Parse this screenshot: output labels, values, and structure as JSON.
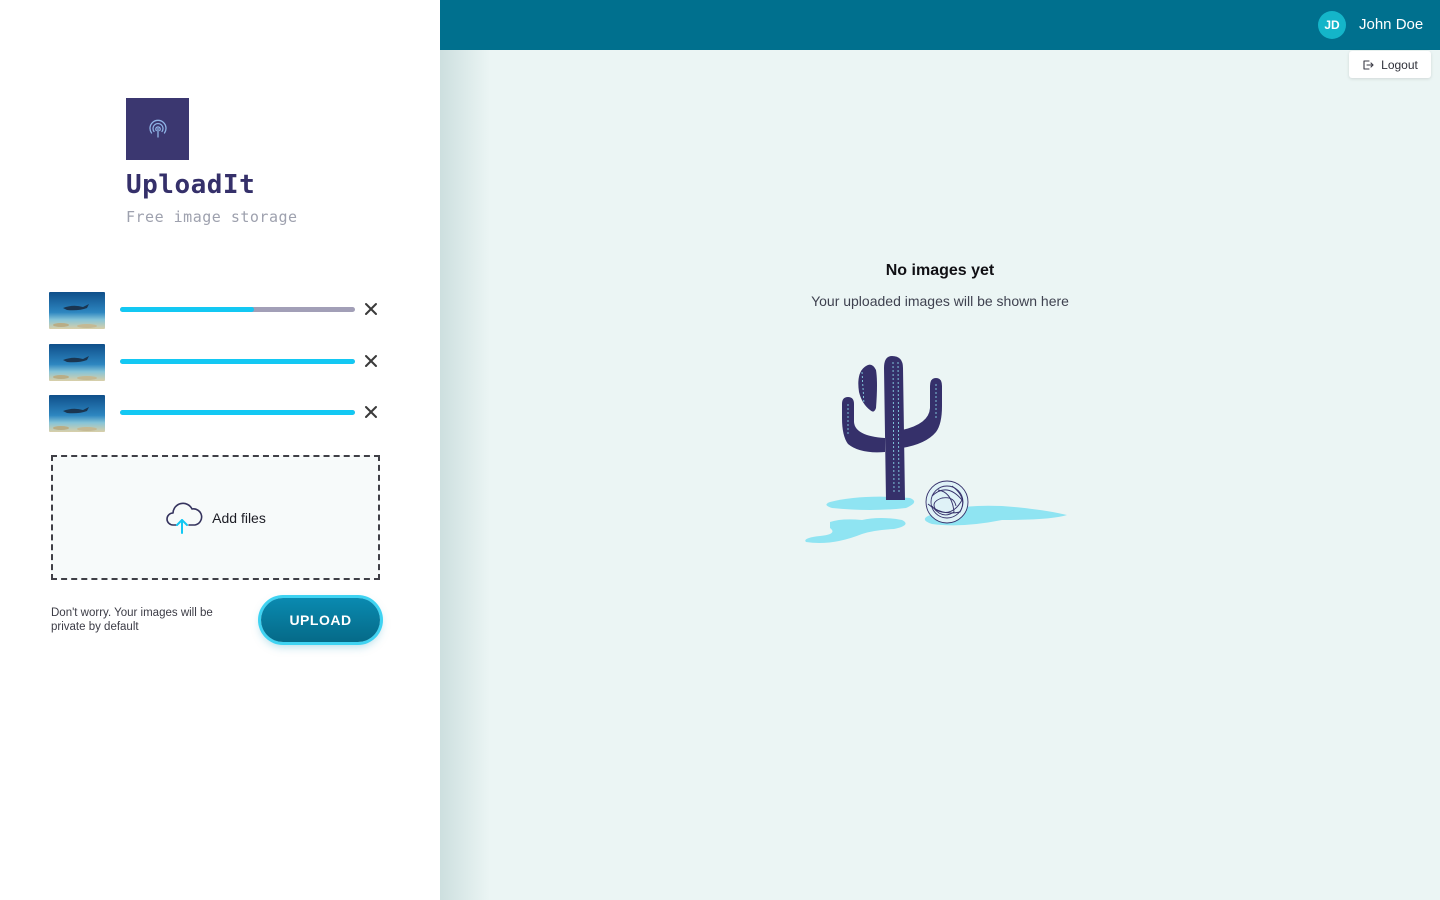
{
  "app": {
    "name": "UploadIt",
    "tagline": "Free image storage"
  },
  "uploads": [
    {
      "progress": 0.57
    },
    {
      "progress": 1.0
    },
    {
      "progress": 1.0
    }
  ],
  "dropzone": {
    "label": "Add files"
  },
  "privacy_note": "Don't worry. Your images will be private by default",
  "upload_button": {
    "label": "UPLOAD"
  },
  "header": {
    "avatar_initials": "JD",
    "user_name": "John Doe",
    "logout_label": "Logout"
  },
  "empty_state": {
    "title": "No images yet",
    "subtitle": "Your uploaded images will be shown here"
  },
  "icons": {
    "logo": "fingerprint-icon",
    "remove": "close-icon",
    "dropzone": "cloud-upload-icon",
    "logout": "logout-icon"
  },
  "colors": {
    "brand": "#3b3770",
    "header": "#00708e",
    "progress_fill": "#13c8f3",
    "progress_track": "#a29fb7",
    "avatar": "#14b5c9",
    "main_background": "#ebf5f4"
  }
}
